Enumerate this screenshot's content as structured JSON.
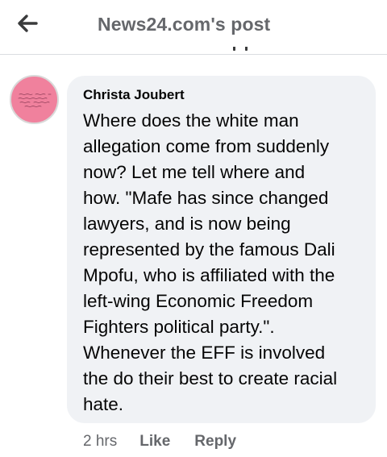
{
  "header": {
    "title": "News24.com's post",
    "back_icon": "arrow-left-icon"
  },
  "comment": {
    "author": "Christa Joubert",
    "text": "Where does the white man\nallegation come from suddenly\nnow?  Let me tell where and\nhow. \"Mafe has since changed\nlawyers, and is now being\nrepresented by the famous Dali\nMpofu, who is affiliated with the\nleft-wing Economic Freedom\nFighters political party.\".\nWhenever the EFF is involved\nthe do their best to create racial\nhate.",
    "avatar_color": "#f0819d",
    "bubble_color": "#f0f2f5"
  },
  "meta": {
    "time": "2 hrs",
    "like_label": "Like",
    "reply_label": "Reply"
  }
}
